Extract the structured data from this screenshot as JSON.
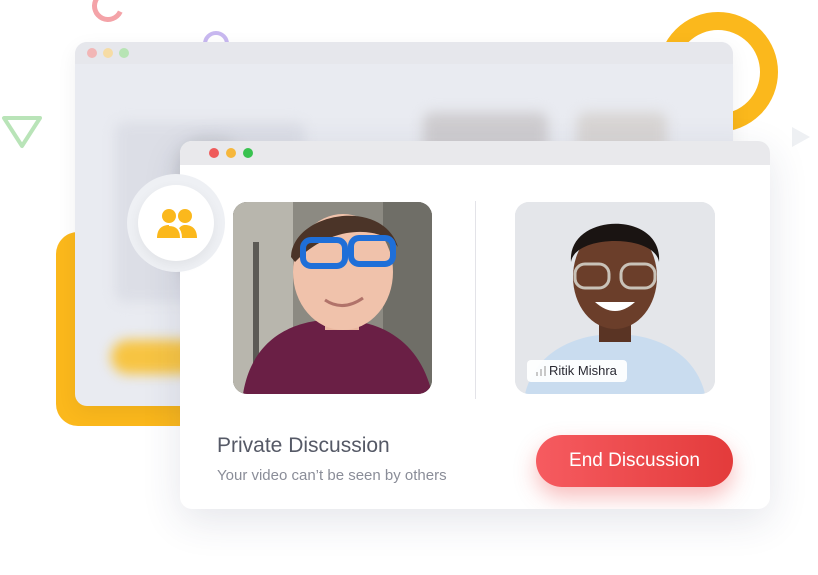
{
  "colors": {
    "accent_yellow": "#fbb81c",
    "button_red": "#ef4a4a",
    "title_text": "#555966",
    "subtitle_text": "#8a8d98"
  },
  "window": {
    "controls": [
      "close",
      "minimize",
      "maximize"
    ]
  },
  "participants": [
    {
      "name": "",
      "avatar": "man-with-blue-glasses"
    },
    {
      "name": "Ritik Mishra",
      "avatar": "man-with-clear-glasses"
    }
  ],
  "call": {
    "title": "Private Discussion",
    "subtitle": "Your video can’t be seen by others",
    "end_button_label": "End Discussion"
  },
  "icons": {
    "badge": "group-icon",
    "signal": "signal-bars-icon"
  }
}
